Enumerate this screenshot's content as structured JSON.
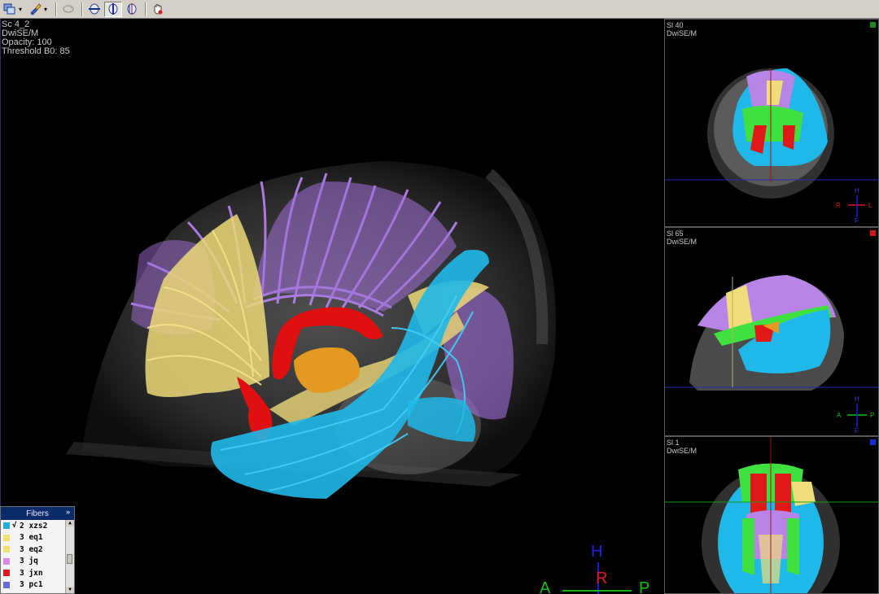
{
  "toolbar": {
    "icons": [
      "layers-icon",
      "paint-brush-icon",
      "rotate-icon",
      "axial-view-icon",
      "sagittal-view-icon",
      "coronal-view-icon",
      "hand-pan-icon"
    ]
  },
  "main_view": {
    "overlay": {
      "series": "Sc 4_2",
      "sequence": "DwiSE/M",
      "opacity": "Opacity: 100",
      "threshold": "Threshold B0: 85"
    },
    "orientation": {
      "head": "H",
      "right": "R",
      "anterior": "A",
      "posterior": "P"
    }
  },
  "side_panels": [
    {
      "slice": "Sl 40",
      "sequence": "DwiSE/M",
      "marker_color": "#1a8a1a",
      "orientation": {
        "left": "R",
        "right": "L",
        "top": "H",
        "bottom": "F"
      }
    },
    {
      "slice": "Sl 65",
      "sequence": "DwiSE/M",
      "marker_color": "#d01818",
      "orientation": {
        "left": "A",
        "right": "P",
        "top": "H",
        "bottom": "F"
      }
    },
    {
      "slice": "Sl 1",
      "sequence": "DwiSE/M",
      "marker_color": "#1a2ad8"
    }
  ],
  "fibers": {
    "title": "Fibers",
    "collapse_glyph": "»",
    "items": [
      {
        "check": "√",
        "name": "2 xzs2",
        "color": "#1fb0e0"
      },
      {
        "check": "",
        "name": "3 eq1",
        "color": "#f0e070"
      },
      {
        "check": "",
        "name": "3 eq2",
        "color": "#f0e070"
      },
      {
        "check": "",
        "name": "3 jq",
        "color": "#e088e8"
      },
      {
        "check": "",
        "name": "3 jxn",
        "color": "#e01818"
      },
      {
        "check": "",
        "name": "3 pc1",
        "color": "#6a6ae0"
      }
    ]
  },
  "colors": {
    "cyan_tract": "#1fb8e8",
    "purple_tract": "#b884e8",
    "yellow_tract": "#f0dc7a",
    "red_tract": "#e01010",
    "orange_tract": "#e89820",
    "green_tract": "#40e040"
  }
}
